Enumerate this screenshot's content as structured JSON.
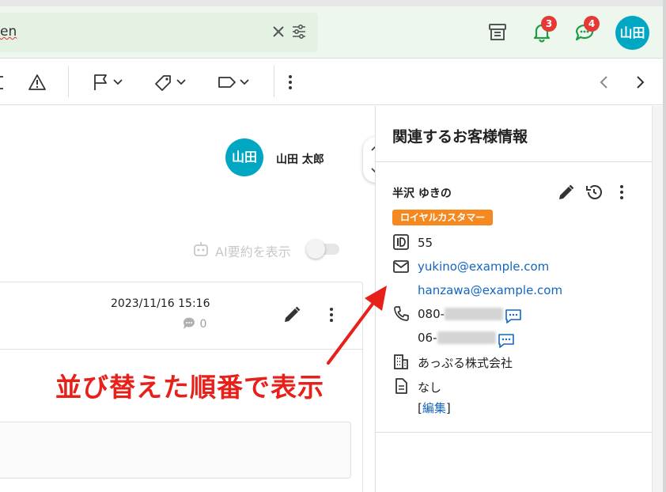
{
  "search": {
    "query_fragment": "en"
  },
  "top_bar": {
    "notifications_badge": "3",
    "chat_badge": "4",
    "avatar_text": "山田",
    "colors": {
      "badge": "#e53935",
      "avatar": "#00a7c2",
      "icon_green": "#1e9e44"
    }
  },
  "toolbar": {
    "icons": [
      "trash-icon",
      "warning-icon",
      "flag-icon",
      "tag-icon",
      "label-icon",
      "more-vert-icon",
      "chevron-left-icon",
      "chevron-right-icon"
    ]
  },
  "conversation": {
    "author_avatar_text": "山田",
    "author_name": "山田 太郎",
    "ai_summary_label": "AI要約を表示",
    "message": {
      "date": "2023/11/16 15:16",
      "comment_count": "0"
    }
  },
  "annotation": {
    "text": "並び替えた順番で表示",
    "color": "#e8201a"
  },
  "customer_panel": {
    "title": "関連するお客様情報",
    "customer": {
      "name": "半沢 ゆきの",
      "tag": "ロイヤルカスタマー",
      "tag_color": "#f5881f",
      "id": "55",
      "email_1": "yukino@example.com",
      "email_2": "hanzawa@example.com",
      "phone_1_prefix": "080-",
      "phone_2_prefix": "06-",
      "company": "あっぷる株式会社",
      "note": "なし",
      "edit_open": "[",
      "edit_label": "編集",
      "edit_close": "]"
    }
  }
}
